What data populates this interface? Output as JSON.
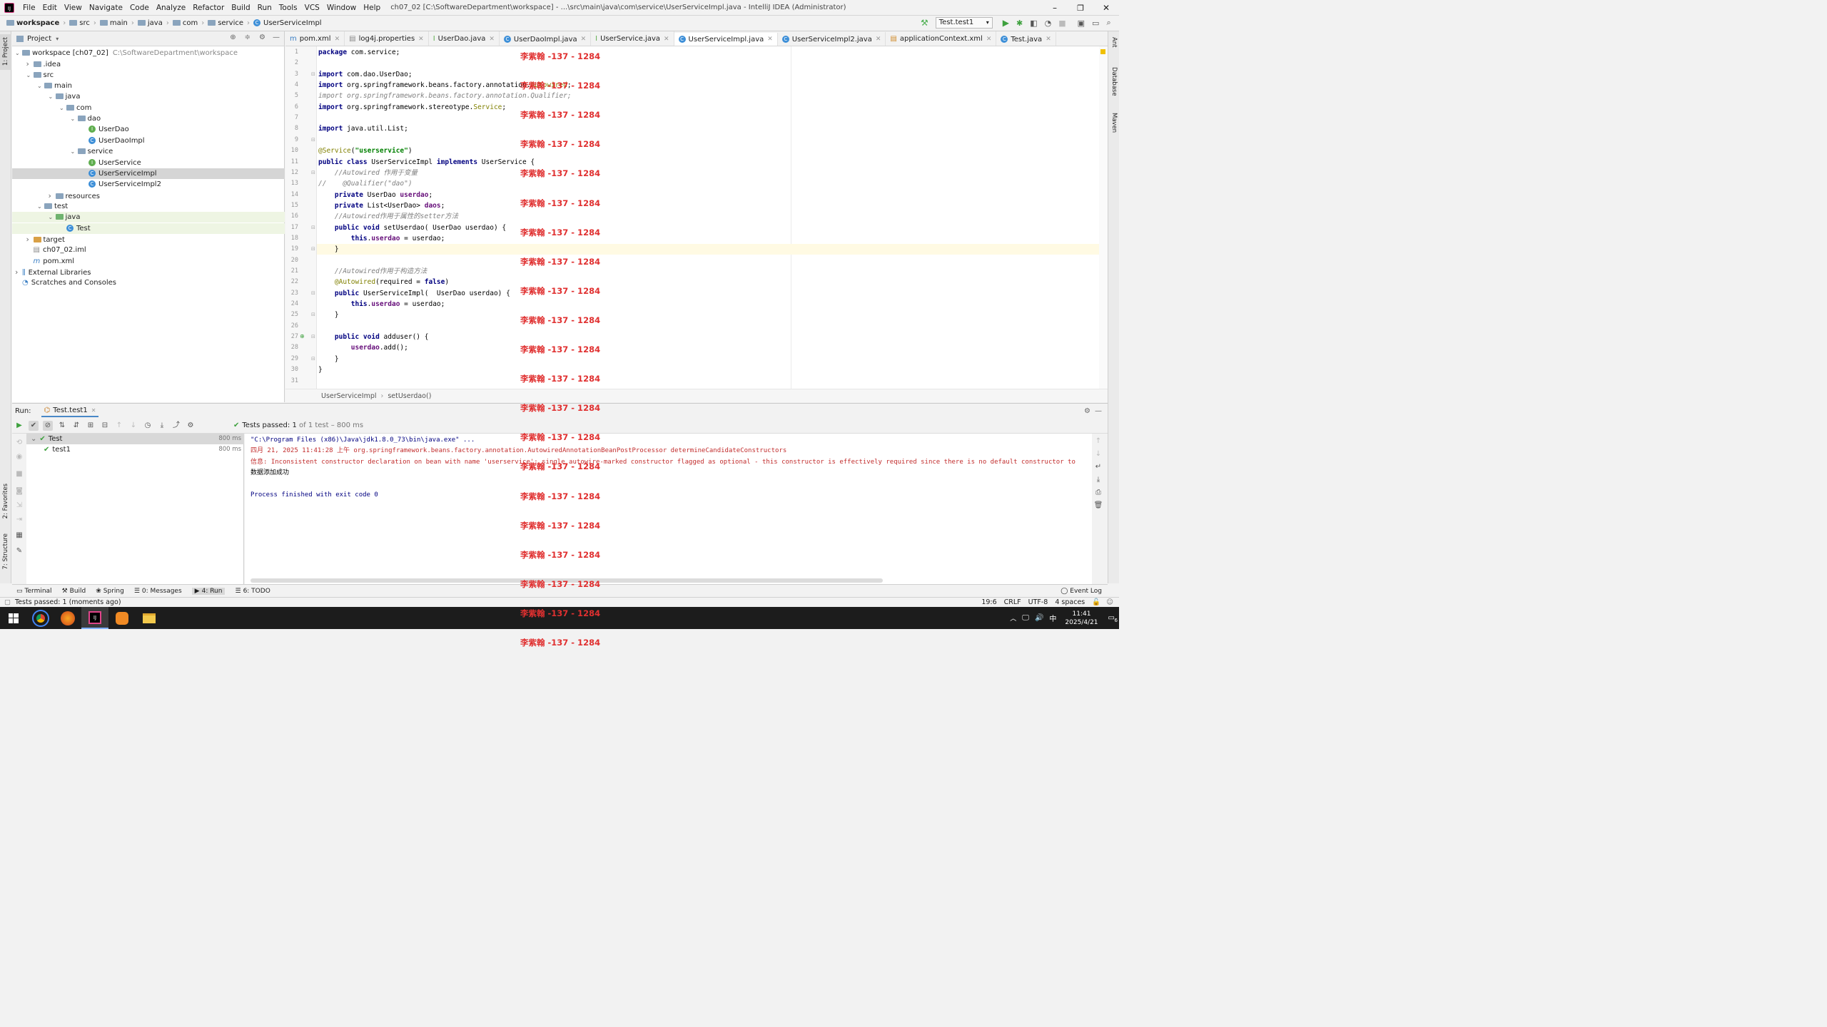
{
  "title_bar": {
    "menu": [
      "File",
      "Edit",
      "View",
      "Navigate",
      "Code",
      "Analyze",
      "Refactor",
      "Build",
      "Run",
      "Tools",
      "VCS",
      "Window",
      "Help"
    ],
    "window_title": "ch07_02 [C:\\SoftwareDepartment\\workspace] - ...\\src\\main\\java\\com\\service\\UserServiceImpl.java - IntelliJ IDEA (Administrator)"
  },
  "nav_bar": {
    "breadcrumbs": [
      "workspace",
      "src",
      "main",
      "java",
      "com",
      "service",
      "UserServiceImpl"
    ],
    "run_config": "Test.test1"
  },
  "left_strip": {
    "project": "1: Project",
    "favorites": "2: Favorites",
    "structure": "7: Structure"
  },
  "right_strip": {
    "ant": "Ant",
    "database": "Database",
    "maven": "Maven"
  },
  "project_panel": {
    "header": "Project",
    "tree": [
      {
        "label": "workspace [ch07_02]",
        "suffix": "C:\\SoftwareDepartment\\workspace",
        "depth": 0,
        "icon": "folder",
        "arrow": "down"
      },
      {
        "label": ".idea",
        "depth": 1,
        "icon": "folder",
        "arrow": "right"
      },
      {
        "label": "src",
        "depth": 1,
        "icon": "folder",
        "arrow": "down"
      },
      {
        "label": "main",
        "depth": 2,
        "icon": "folder",
        "arrow": "down"
      },
      {
        "label": "java",
        "depth": 3,
        "icon": "folder",
        "arrow": "down"
      },
      {
        "label": "com",
        "depth": 4,
        "icon": "folder",
        "arrow": "down"
      },
      {
        "label": "dao",
        "depth": 5,
        "icon": "folder",
        "arrow": "down"
      },
      {
        "label": "UserDao",
        "depth": 6,
        "icon": "interface"
      },
      {
        "label": "UserDaoImpl",
        "depth": 6,
        "icon": "class"
      },
      {
        "label": "service",
        "depth": 5,
        "icon": "folder",
        "arrow": "down"
      },
      {
        "label": "UserService",
        "depth": 6,
        "icon": "interface"
      },
      {
        "label": "UserServiceImpl",
        "depth": 6,
        "icon": "class",
        "selected": true
      },
      {
        "label": "UserServiceImpl2",
        "depth": 6,
        "icon": "class"
      },
      {
        "label": "resources",
        "depth": 3,
        "icon": "folder",
        "arrow": "right"
      },
      {
        "label": "test",
        "depth": 2,
        "icon": "folder",
        "arrow": "down"
      },
      {
        "label": "java",
        "depth": 3,
        "icon": "folder-green",
        "arrow": "down",
        "highlight": true
      },
      {
        "label": "Test",
        "depth": 4,
        "icon": "test-class",
        "highlight": true
      },
      {
        "label": "target",
        "depth": 1,
        "icon": "folder-orange",
        "arrow": "right"
      },
      {
        "label": "ch07_02.iml",
        "depth": 1,
        "icon": "file"
      },
      {
        "label": "pom.xml",
        "depth": 1,
        "icon": "maven"
      },
      {
        "label": "External Libraries",
        "depth": 0,
        "icon": "library",
        "arrow": "right"
      },
      {
        "label": "Scratches and Consoles",
        "depth": 0,
        "icon": "scratch"
      }
    ]
  },
  "editor": {
    "tabs": [
      {
        "label": "pom.xml"
      },
      {
        "label": "log4j.properties"
      },
      {
        "label": "UserDao.java"
      },
      {
        "label": "UserDaoImpl.java"
      },
      {
        "label": "UserService.java"
      },
      {
        "label": "UserServiceImpl.java",
        "active": true
      },
      {
        "label": "UserServiceImpl2.java"
      },
      {
        "label": "applicationContext.xml"
      },
      {
        "label": "Test.java"
      }
    ],
    "current_line": 19,
    "lines": [
      [
        {
          "t": "package ",
          "c": "kw"
        },
        {
          "t": "com.service;"
        }
      ],
      [],
      [
        {
          "t": "import ",
          "c": "kw"
        },
        {
          "t": "com.dao.UserDao;"
        }
      ],
      [
        {
          "t": "import ",
          "c": "kw"
        },
        {
          "t": "org.springframework.beans.factory.annotation."
        },
        {
          "t": "Autowired",
          "c": "ann"
        },
        {
          "t": ";"
        }
      ],
      [
        {
          "t": "import ",
          "c": "cm"
        },
        {
          "t": "org.springframework.beans.factory.annotation.Qualifier;",
          "c": "cm"
        }
      ],
      [
        {
          "t": "import ",
          "c": "kw"
        },
        {
          "t": "org.springframework.stereotype."
        },
        {
          "t": "Service",
          "c": "ann"
        },
        {
          "t": ";"
        }
      ],
      [],
      [
        {
          "t": "import ",
          "c": "kw"
        },
        {
          "t": "java.util.List;"
        }
      ],
      [],
      [
        {
          "t": "@Service",
          "c": "ann"
        },
        {
          "t": "("
        },
        {
          "t": "\"userservice\"",
          "c": "str"
        },
        {
          "t": ")"
        }
      ],
      [
        {
          "t": "public class ",
          "c": "kw"
        },
        {
          "t": "UserServiceImpl "
        },
        {
          "t": "implements ",
          "c": "kw"
        },
        {
          "t": "UserService {"
        }
      ],
      [
        {
          "t": "    //Autowired 作用于变量",
          "c": "cm"
        }
      ],
      [
        {
          "t": "//    @Qualifier(\"dao\")",
          "c": "cm"
        }
      ],
      [
        {
          "t": "    "
        },
        {
          "t": "private ",
          "c": "kw"
        },
        {
          "t": "UserDao "
        },
        {
          "t": "userdao",
          "c": "fld"
        },
        {
          "t": ";"
        }
      ],
      [
        {
          "t": "    "
        },
        {
          "t": "private ",
          "c": "kw"
        },
        {
          "t": "List<UserDao> "
        },
        {
          "t": "daos",
          "c": "fld"
        },
        {
          "t": ";"
        }
      ],
      [
        {
          "t": "    //Autowired作用于属性的setter方法",
          "c": "cm"
        }
      ],
      [
        {
          "t": "    "
        },
        {
          "t": "public void ",
          "c": "kw"
        },
        {
          "t": "setUserdao"
        },
        {
          "t": "( UserDao userdao) {"
        }
      ],
      [
        {
          "t": "        "
        },
        {
          "t": "this",
          "c": "kw"
        },
        {
          "t": "."
        },
        {
          "t": "userdao",
          "c": "fld"
        },
        {
          "t": " = userdao;"
        }
      ],
      [
        {
          "t": "    }"
        }
      ],
      [],
      [
        {
          "t": "    //Autowired作用于构造方法",
          "c": "cm"
        }
      ],
      [
        {
          "t": "    "
        },
        {
          "t": "@Autowired",
          "c": "ann"
        },
        {
          "t": "(required = "
        },
        {
          "t": "false",
          "c": "kw"
        },
        {
          "t": ")"
        }
      ],
      [
        {
          "t": "    "
        },
        {
          "t": "public ",
          "c": "kw"
        },
        {
          "t": "UserServiceImpl(  UserDao userdao) {"
        }
      ],
      [
        {
          "t": "        "
        },
        {
          "t": "this",
          "c": "kw"
        },
        {
          "t": "."
        },
        {
          "t": "userdao",
          "c": "fld"
        },
        {
          "t": " = userdao;"
        }
      ],
      [
        {
          "t": "    }"
        }
      ],
      [],
      [
        {
          "t": "    "
        },
        {
          "t": "public void ",
          "c": "kw"
        },
        {
          "t": "adduser() {"
        }
      ],
      [
        {
          "t": "        "
        },
        {
          "t": "userdao",
          "c": "fld"
        },
        {
          "t": ".add();"
        }
      ],
      [
        {
          "t": "    }"
        }
      ],
      [
        {
          "t": "}"
        }
      ],
      []
    ],
    "breadcrumb": [
      "UserServiceImpl",
      "setUserdao()"
    ]
  },
  "watermark": "李紫翰 -137 - 1284",
  "run_panel": {
    "label": "Run:",
    "tab": "Test.test1",
    "status_prefix": "Tests passed:",
    "status_count": "1",
    "status_suffix": "of 1 test – 800 ms",
    "tests": [
      {
        "name": "Test",
        "time": "800 ms"
      },
      {
        "name": "test1",
        "time": "800 ms"
      }
    ],
    "console": [
      {
        "text": "\"C:\\Program Files (x86)\\Java\\jdk1.8.0_73\\bin\\java.exe\" ...",
        "color": "#000080"
      },
      {
        "text": "四月 21, 2025 11:41:28 上午 org.springframework.beans.factory.annotation.AutowiredAnnotationBeanPostProcessor determineCandidateConstructors",
        "color": "#c22d2d"
      },
      {
        "text": "信息: Inconsistent constructor declaration on bean with name 'userservice': single autowire-marked constructor flagged as optional - this constructor is effectively required since there is no default constructor to",
        "color": "#c22d2d"
      },
      {
        "text": "数据添加成功",
        "color": "#000000"
      },
      {
        "text": "",
        "color": "#000000"
      },
      {
        "text": "Process finished with exit code 0",
        "color": "#000080"
      }
    ]
  },
  "bottom_tabs": [
    "Terminal",
    "Build",
    "Spring",
    "0: Messages",
    "4: Run",
    "6: TODO"
  ],
  "event_log": "Event Log",
  "status_bar": {
    "message": "Tests passed: 1 (moments ago)",
    "position": "19:6",
    "line_sep": "CRLF",
    "encoding": "UTF-8",
    "indent": "4 spaces"
  },
  "taskbar": {
    "time": "11:41",
    "date": "2025/4/21",
    "ime": "中",
    "notifications": "6"
  },
  "colors": {
    "accent": "#4a88c7",
    "watermark": "#e03030",
    "run_green": "#4caf50"
  }
}
